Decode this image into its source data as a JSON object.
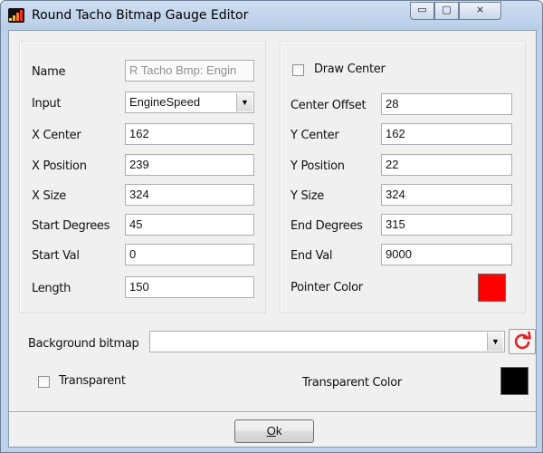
{
  "window": {
    "title": "Round Tacho Bitmap Gauge Editor",
    "controls": {
      "minimize": "▭",
      "maximize": "▢",
      "close": "⨯"
    }
  },
  "left_group": {
    "name_label": "Name",
    "name_value": "R Tacho Bmp: Engin",
    "input_label": "Input",
    "input_value": "EngineSpeed",
    "x_center_label": "X Center",
    "x_center_value": "162",
    "x_position_label": "X Position",
    "x_position_value": "239",
    "x_size_label": "X Size",
    "x_size_value": "324",
    "start_degrees_label": "Start Degrees",
    "start_degrees_value": "45",
    "start_val_label": "Start Val",
    "start_val_value": "0",
    "length_label": "Length",
    "length_value": "150"
  },
  "right_group": {
    "draw_center_label": "Draw Center",
    "draw_center_checked": false,
    "center_offset_label": "Center Offset",
    "center_offset_value": "28",
    "y_center_label": "Y Center",
    "y_center_value": "162",
    "y_position_label": "Y Position",
    "y_position_value": "22",
    "y_size_label": "Y Size",
    "y_size_value": "324",
    "end_degrees_label": "End Degrees",
    "end_degrees_value": "315",
    "end_val_label": "End Val",
    "end_val_value": "9000",
    "pointer_color_label": "Pointer Color",
    "pointer_color": "#ff0000"
  },
  "background": {
    "bitmap_label": "Background bitmap",
    "bitmap_value": "",
    "transparent_label": "Transparent",
    "transparent_checked": false,
    "transparent_color_label": "Transparent Color",
    "transparent_color": "#000000"
  },
  "footer": {
    "ok_mnemonic": "O",
    "ok_rest": "k"
  },
  "icons": {
    "app": "gauge-app-icon",
    "refresh": "refresh-icon",
    "dropdown": "chevron-down-icon"
  },
  "colors": {
    "accent_red": "#ff0000",
    "title_bar": "#bcd1ea"
  }
}
